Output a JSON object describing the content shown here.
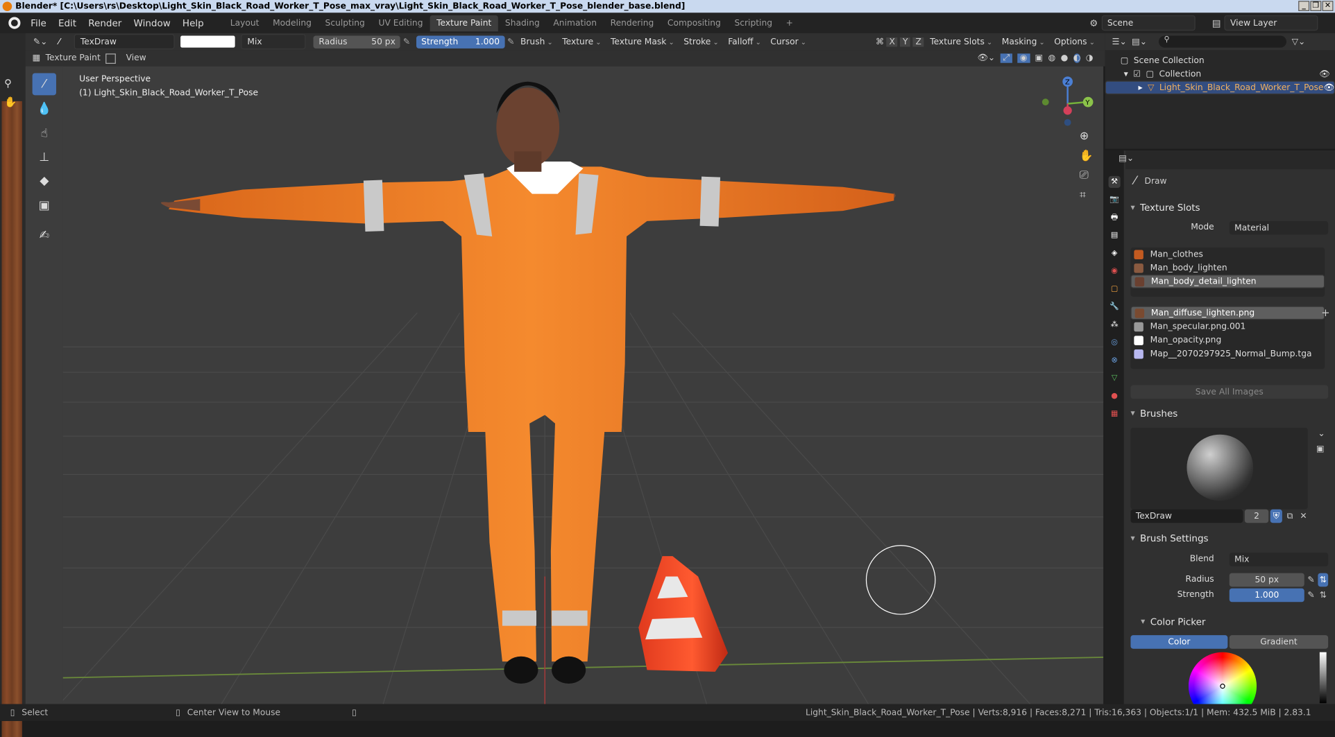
{
  "window": {
    "title": "Blender* [C:\\Users\\rs\\Desktop\\Light_Skin_Black_Road_Worker_T_Pose_max_vray\\Light_Skin_Black_Road_Worker_T_Pose_blender_base.blend]",
    "controls": [
      "_",
      "❐",
      "✕"
    ]
  },
  "menu": [
    "File",
    "Edit",
    "Render",
    "Window",
    "Help"
  ],
  "workspaces": [
    "Layout",
    "Modeling",
    "Sculpting",
    "UV Editing",
    "Texture Paint",
    "Shading",
    "Animation",
    "Rendering",
    "Compositing",
    "Scripting"
  ],
  "active_workspace": "Texture Paint",
  "scene": "Scene",
  "view_layer": "View Layer",
  "header": {
    "brush_name": "TexDraw",
    "blend": "Mix",
    "radius_label": "Radius",
    "radius_value": "50 px",
    "strength_label": "Strength",
    "strength_value": "1.000",
    "menus": [
      "Brush",
      "Texture",
      "Texture Mask",
      "Stroke",
      "Falloff",
      "Cursor"
    ],
    "axes": [
      "X",
      "Y",
      "Z"
    ],
    "right_menus": [
      "Texture Slots",
      "Masking",
      "Options"
    ]
  },
  "header2": {
    "mode": "Texture Paint",
    "view": "View"
  },
  "viewport": {
    "perspective": "User Perspective",
    "object": "(1) Light_Skin_Black_Road_Worker_T_Pose",
    "gizmo": {
      "z": "Z",
      "y": "Y"
    }
  },
  "outliner": {
    "root": "Scene Collection",
    "collection": "Collection",
    "object": "Light_Skin_Black_Road_Worker_T_Pose"
  },
  "properties": {
    "tool": "Draw",
    "texture_slots": {
      "title": "Texture Slots",
      "mode_label": "Mode",
      "mode_value": "Material",
      "materials": [
        "Man_clothes",
        "Man_body_lighten",
        "Man_body_detail_lighten"
      ],
      "selected_material": 2,
      "images": [
        "Man_diffuse_lighten.png",
        "Man_specular.png.001",
        "Man_opacity.png",
        "Map__2070297925_Normal_Bump.tga"
      ],
      "save_all": "Save All Images"
    },
    "brushes": {
      "title": "Brushes",
      "name": "TexDraw",
      "users": "2"
    },
    "brush_settings": {
      "title": "Brush Settings",
      "blend_label": "Blend",
      "blend_value": "Mix",
      "radius_label": "Radius",
      "radius_value": "50 px",
      "strength_label": "Strength",
      "strength_value": "1.000"
    },
    "color_picker": {
      "title": "Color Picker",
      "tabs": [
        "Color",
        "Gradient"
      ],
      "active_tab": "Color"
    }
  },
  "statusbar": {
    "left": "Select",
    "mid": "Center View to Mouse",
    "right": "Light_Skin_Black_Road_Worker_T_Pose | Verts:8,916 | Faces:8,271 | Tris:16,363 | Objects:1/1 | Mem: 432.5 MiB | 2.83.1"
  }
}
